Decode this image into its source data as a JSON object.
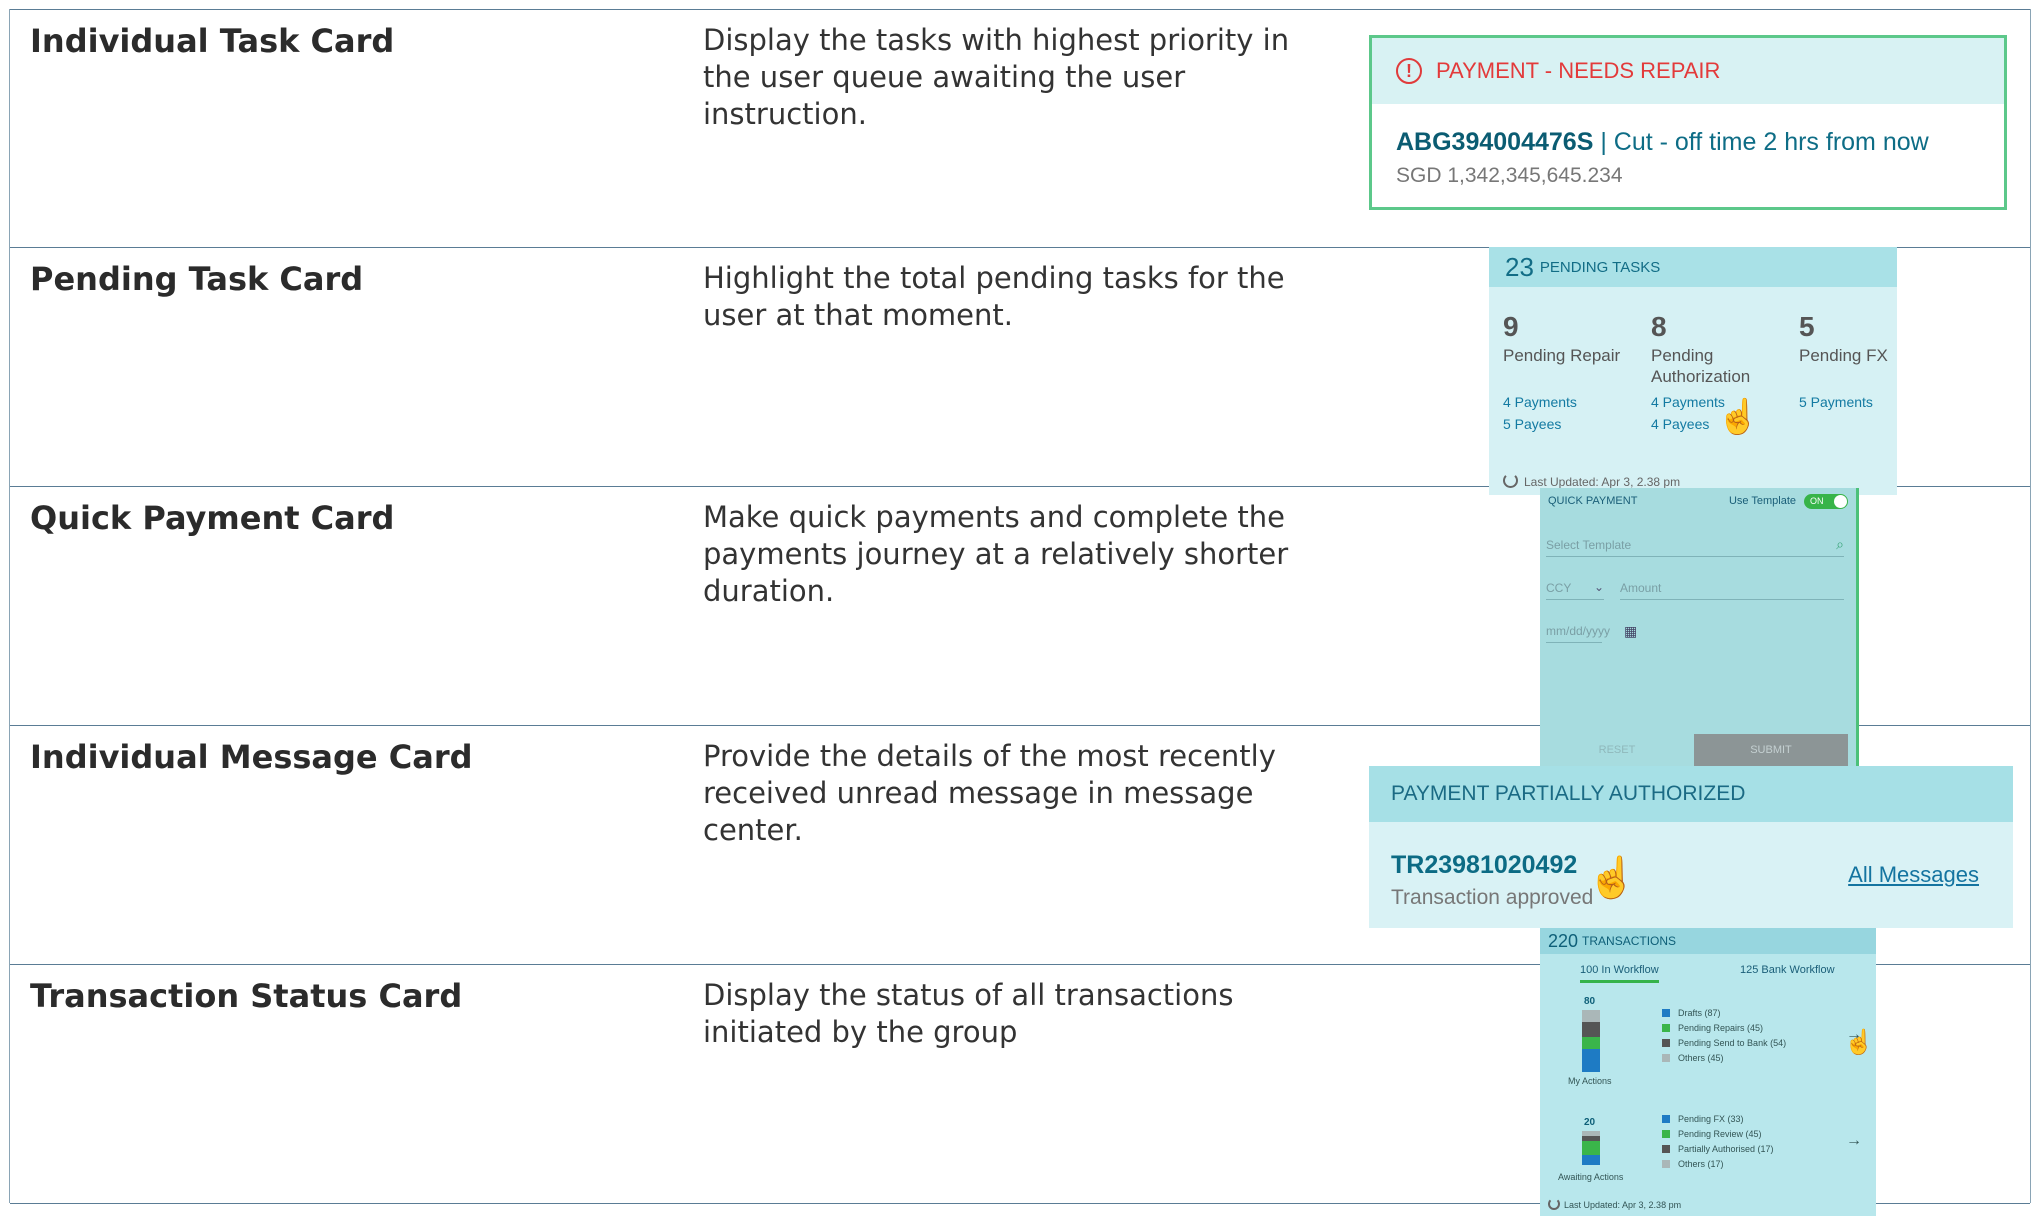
{
  "rows": [
    {
      "name": "Individual Task Card",
      "description": "Display the tasks with highest priority in the user queue awaiting the user instruction."
    },
    {
      "name": "Pending Task Card",
      "description": "Highlight the total pending tasks for the user at that moment."
    },
    {
      "name": "Quick Payment Card",
      "description": "Make quick payments and complete the payments journey at a relatively shorter duration."
    },
    {
      "name": "Individual Message Card",
      "description": "Provide the details of the most recently received unread message in message center."
    },
    {
      "name": "Transaction Status Card",
      "description": "Display the status of all transactions initiated by the group"
    }
  ],
  "task_card": {
    "status": "PAYMENT - NEEDS REPAIR",
    "ref": "ABG394004476S",
    "cutoff": " | Cut - off time 2 hrs from now",
    "amount": "SGD 1,342,345,645.234",
    "status_color": "#e33a3a"
  },
  "pending_card": {
    "total": "23",
    "label": "PENDING TASKS",
    "columns": [
      {
        "count": "9",
        "title": "Pending Repair",
        "links": [
          "4 Payments",
          "5 Payees"
        ]
      },
      {
        "count": "8",
        "title": "Pending Authorization",
        "links": [
          "4 Payments",
          "4 Payees"
        ]
      },
      {
        "count": "5",
        "title": "Pending FX",
        "links": [
          "5 Payments"
        ]
      }
    ],
    "updated": "Last Updated: Apr 3, 2.38 pm"
  },
  "quick_payment": {
    "title": "QUICK PAYMENT",
    "template_label": "Use Template",
    "toggle": "ON",
    "select_placeholder": "Select Template",
    "ccy": "CCY",
    "amount": "Amount",
    "date": "mm/dd/yyyy",
    "reset": "RESET",
    "submit": "SUBMIT"
  },
  "message_card": {
    "title": "PAYMENT PARTIALLY AUTHORIZED",
    "ref": "TR23981020492",
    "sub": "Transaction approved",
    "link": "All Messages"
  },
  "transactions": {
    "total": "220",
    "label": "TRANSACTIONS",
    "tabs": [
      "100 In Workflow",
      "125 Bank Workflow"
    ],
    "group1": {
      "value": "80",
      "label": "My Actions",
      "legend": [
        "Drafts (87)",
        "Pending Repairs (45)",
        "Pending Send to Bank (54)",
        "Others (45)"
      ]
    },
    "group2": {
      "value": "20",
      "label": "Awaiting Actions",
      "legend": [
        "Pending FX (33)",
        "Pending Review (45)",
        "Partially Authorised (17)",
        "Others (17)"
      ]
    },
    "updated": "Last Updated: Apr 3, 2.38 pm",
    "colors": [
      "#1e7bc4",
      "#3ab54a",
      "#555555",
      "#aab7b8"
    ]
  }
}
